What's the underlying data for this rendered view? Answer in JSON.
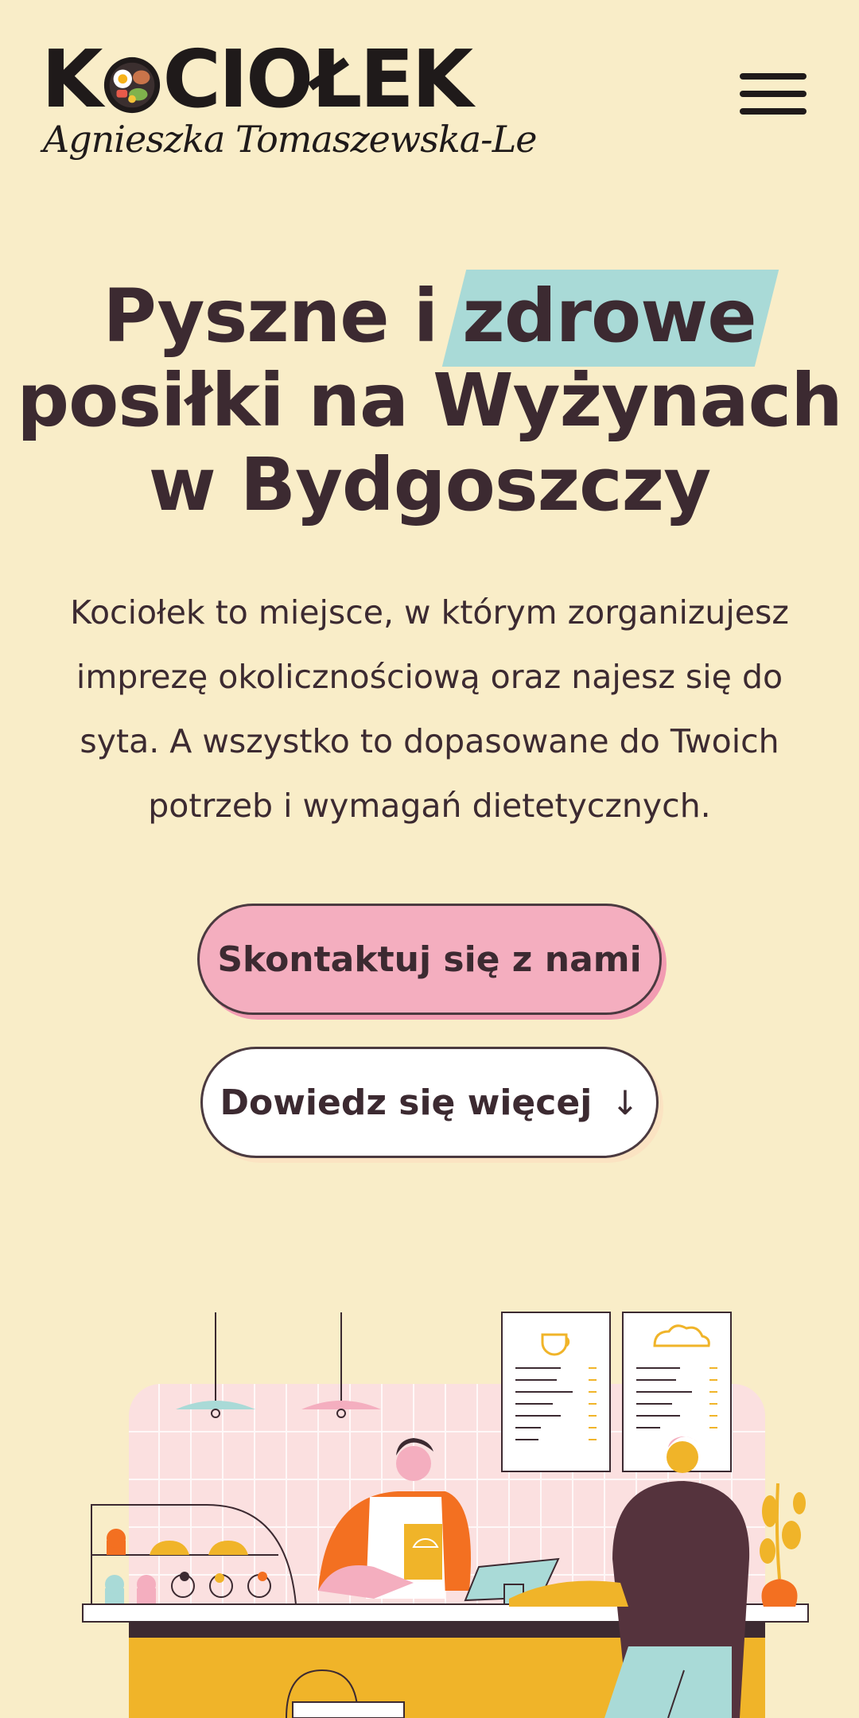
{
  "header": {
    "logo_text_left": "K",
    "logo_text_right": "CIOŁEK",
    "logo_subtitle": "Agnieszka Tomaszewska-Le",
    "menu_icon": "hamburger-icon"
  },
  "hero": {
    "title_part1": "Pyszne i ",
    "title_highlight": "zdrowe",
    "title_line2": "posiłki na Wyżynach",
    "title_line3": "w Bydgoszczy",
    "description": "Kociołek to miejsce, w którym zorganizujesz imprezę okolicznościową oraz najesz się do syta. A wszystko to dopasowane do Twoich potrzeb i wymagań dietetycznych."
  },
  "buttons": {
    "contact_label": "Skontaktuj się z nami",
    "learn_more_label": "Dowiedz się więcej",
    "learn_more_icon": "arrow-down-icon"
  },
  "colors": {
    "background": "#f9edc8",
    "text": "#3c2a31",
    "highlight": "#a9dad7",
    "primary_button": "#f4aebf"
  }
}
